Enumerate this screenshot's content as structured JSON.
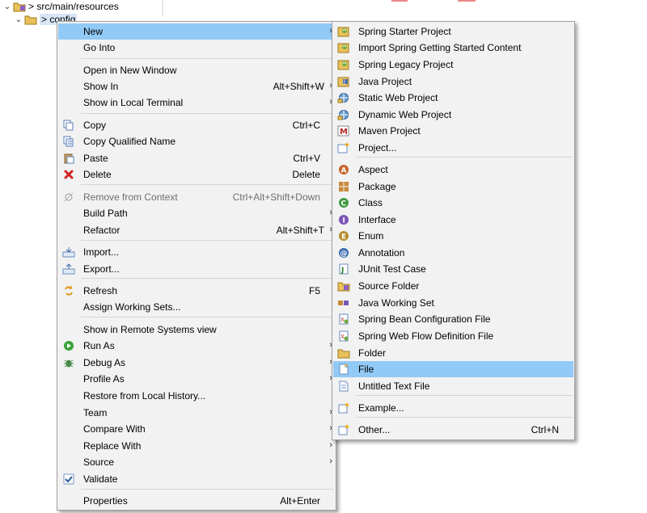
{
  "tree": {
    "row1": {
      "label": "> src/main/resources",
      "twisty": "⌄"
    },
    "row2": {
      "label": "> config",
      "twisty": "⌄"
    }
  },
  "context_menu": {
    "items": [
      {
        "label": "New",
        "accel": "",
        "submenu": true,
        "icon": "",
        "highlight": true
      },
      {
        "label": "Go Into",
        "accel": "",
        "submenu": false,
        "icon": ""
      },
      {
        "label": "Open in New Window",
        "accel": "",
        "submenu": false,
        "icon": ""
      },
      {
        "label": "Show In",
        "accel": "Alt+Shift+W",
        "submenu": true,
        "icon": ""
      },
      {
        "label": "Show in Local Terminal",
        "accel": "",
        "submenu": true,
        "icon": ""
      },
      {
        "label": "Copy",
        "accel": "Ctrl+C",
        "submenu": false,
        "icon": "copy-icon"
      },
      {
        "label": "Copy Qualified Name",
        "accel": "",
        "submenu": false,
        "icon": "copy-qualified-icon"
      },
      {
        "label": "Paste",
        "accel": "Ctrl+V",
        "submenu": false,
        "icon": "paste-icon"
      },
      {
        "label": "Delete",
        "accel": "Delete",
        "submenu": false,
        "icon": "delete-icon"
      },
      {
        "label": "Remove from Context",
        "accel": "Ctrl+Alt+Shift+Down",
        "submenu": false,
        "icon": "remove-context-icon",
        "disabled": true
      },
      {
        "label": "Build Path",
        "accel": "",
        "submenu": true,
        "icon": ""
      },
      {
        "label": "Refactor",
        "accel": "Alt+Shift+T",
        "submenu": true,
        "icon": ""
      },
      {
        "label": "Import...",
        "accel": "",
        "submenu": false,
        "icon": "import-icon"
      },
      {
        "label": "Export...",
        "accel": "",
        "submenu": false,
        "icon": "export-icon"
      },
      {
        "label": "Refresh",
        "accel": "F5",
        "submenu": false,
        "icon": "refresh-icon"
      },
      {
        "label": "Assign Working Sets...",
        "accel": "",
        "submenu": false,
        "icon": ""
      },
      {
        "label": "Show in Remote Systems view",
        "accel": "",
        "submenu": false,
        "icon": ""
      },
      {
        "label": "Run As",
        "accel": "",
        "submenu": true,
        "icon": "run-icon"
      },
      {
        "label": "Debug As",
        "accel": "",
        "submenu": true,
        "icon": "debug-icon"
      },
      {
        "label": "Profile As",
        "accel": "",
        "submenu": true,
        "icon": ""
      },
      {
        "label": "Restore from Local History...",
        "accel": "",
        "submenu": false,
        "icon": ""
      },
      {
        "label": "Team",
        "accel": "",
        "submenu": true,
        "icon": ""
      },
      {
        "label": "Compare With",
        "accel": "",
        "submenu": true,
        "icon": ""
      },
      {
        "label": "Replace With",
        "accel": "",
        "submenu": true,
        "icon": ""
      },
      {
        "label": "Source",
        "accel": "",
        "submenu": true,
        "icon": ""
      },
      {
        "label": "Validate",
        "accel": "",
        "submenu": false,
        "icon": "check-icon"
      },
      {
        "label": "Properties",
        "accel": "Alt+Enter",
        "submenu": false,
        "icon": ""
      }
    ]
  },
  "new_submenu": {
    "items": [
      {
        "label": "Spring Starter Project",
        "accel": "",
        "icon": "spring-project-icon"
      },
      {
        "label": "Import Spring Getting Started Content",
        "accel": "",
        "icon": "spring-project-icon"
      },
      {
        "label": "Spring Legacy Project",
        "accel": "",
        "icon": "spring-project-icon"
      },
      {
        "label": "Java Project",
        "accel": "",
        "icon": "java-project-icon"
      },
      {
        "label": "Static Web Project",
        "accel": "",
        "icon": "web-project-icon"
      },
      {
        "label": "Dynamic Web Project",
        "accel": "",
        "icon": "web-project-icon"
      },
      {
        "label": "Maven Project",
        "accel": "",
        "icon": "maven-icon"
      },
      {
        "label": "Project...",
        "accel": "",
        "icon": "new-project-icon"
      },
      {
        "label": "Aspect",
        "accel": "",
        "icon": "aspect-icon"
      },
      {
        "label": "Package",
        "accel": "",
        "icon": "package-icon"
      },
      {
        "label": "Class",
        "accel": "",
        "icon": "class-icon"
      },
      {
        "label": "Interface",
        "accel": "",
        "icon": "interface-icon"
      },
      {
        "label": "Enum",
        "accel": "",
        "icon": "enum-icon"
      },
      {
        "label": "Annotation",
        "accel": "",
        "icon": "annotation-icon"
      },
      {
        "label": "JUnit Test Case",
        "accel": "",
        "icon": "junit-icon"
      },
      {
        "label": "Source Folder",
        "accel": "",
        "icon": "source-folder-icon"
      },
      {
        "label": "Java Working Set",
        "accel": "",
        "icon": "working-set-icon"
      },
      {
        "label": "Spring Bean Configuration File",
        "accel": "",
        "icon": "spring-xml-icon"
      },
      {
        "label": "Spring Web Flow Definition File",
        "accel": "",
        "icon": "spring-xml-icon"
      },
      {
        "label": "Folder",
        "accel": "",
        "icon": "folder-icon"
      },
      {
        "label": "File",
        "accel": "",
        "icon": "file-icon",
        "highlight": true
      },
      {
        "label": "Untitled Text File",
        "accel": "",
        "icon": "text-file-icon"
      },
      {
        "label": "Example...",
        "accel": "",
        "icon": "example-icon"
      },
      {
        "label": "Other...",
        "accel": "Ctrl+N",
        "icon": "other-icon"
      }
    ]
  }
}
